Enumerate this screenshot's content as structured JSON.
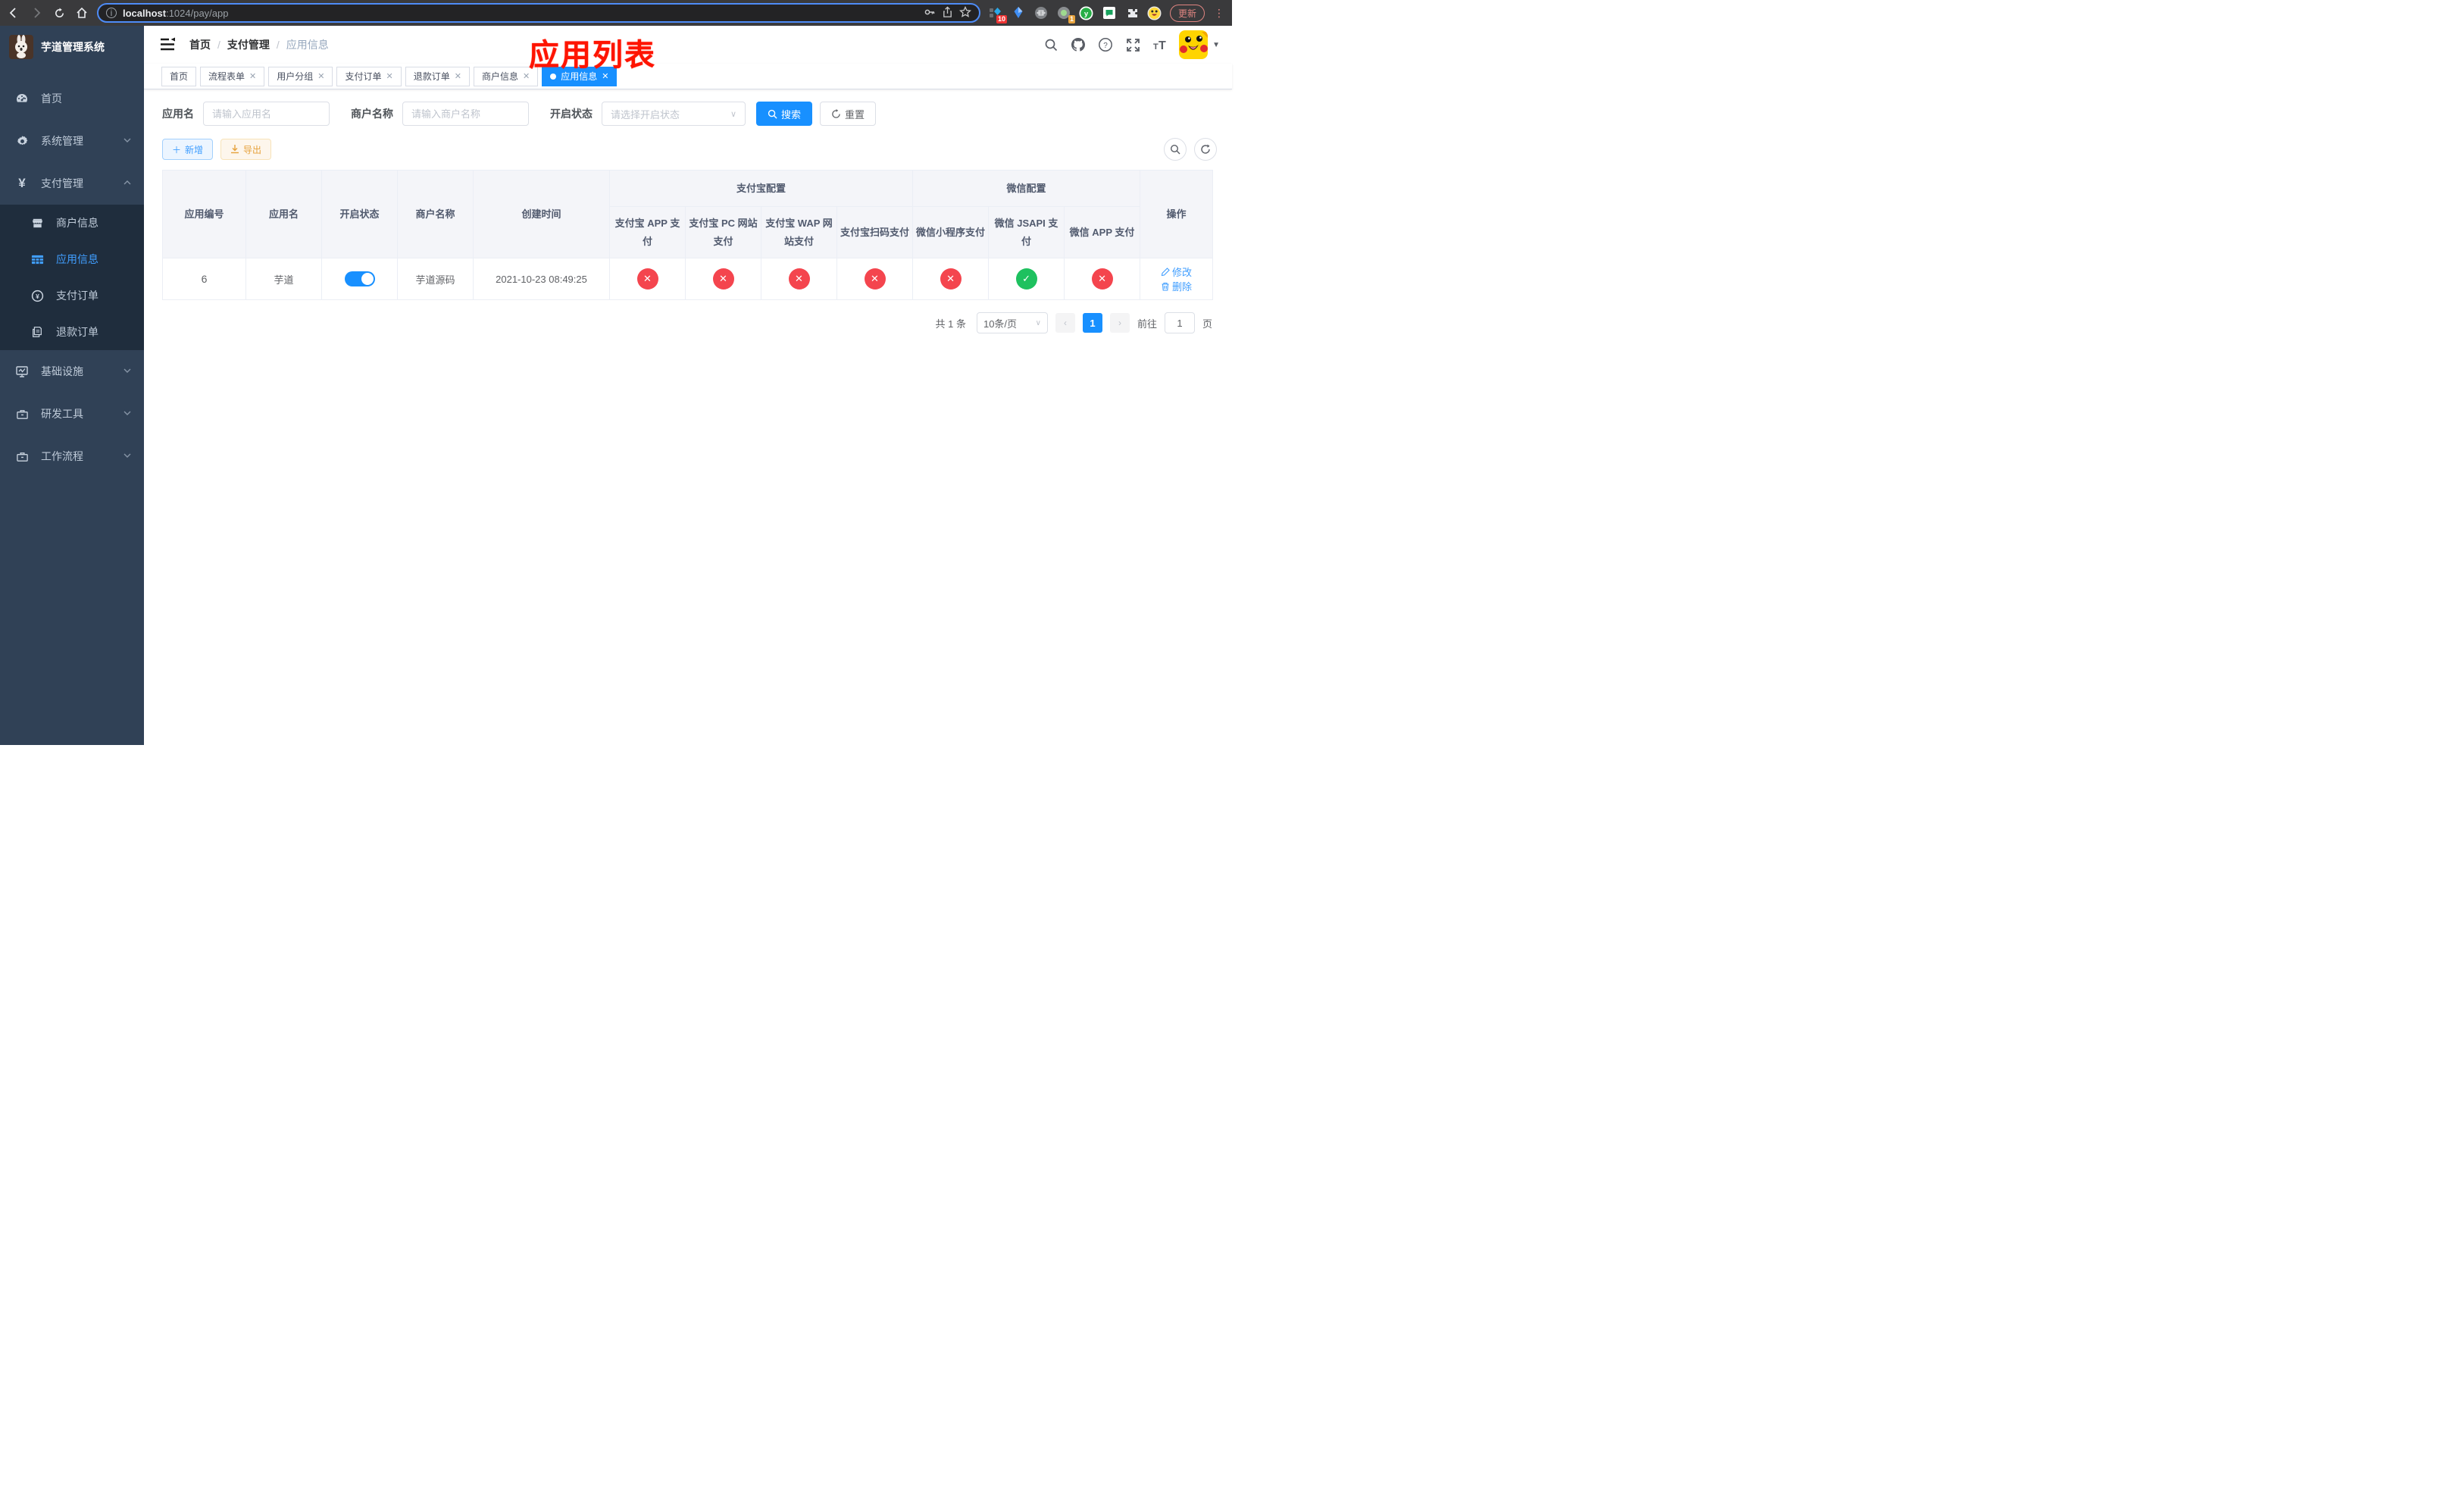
{
  "browser": {
    "url_host": "localhost",
    "url_rest": ":1024/pay/app",
    "update_label": "更新",
    "ext_badge_blue": "10",
    "ext_badge_orange": "1"
  },
  "sidebar": {
    "title": "芋道管理系统",
    "home": "首页",
    "system": "系统管理",
    "pay": "支付管理",
    "merchant_info": "商户信息",
    "app_info": "应用信息",
    "pay_order": "支付订单",
    "refund_order": "退款订单",
    "infra": "基础设施",
    "dev_tools": "研发工具",
    "workflow": "工作流程"
  },
  "breadcrumb": {
    "items": [
      "首页",
      "支付管理",
      "应用信息"
    ]
  },
  "annotation": "应用列表",
  "tabs": [
    {
      "label": "首页",
      "closable": false,
      "active": false
    },
    {
      "label": "流程表单",
      "closable": true,
      "active": false
    },
    {
      "label": "用户分组",
      "closable": true,
      "active": false
    },
    {
      "label": "支付订单",
      "closable": true,
      "active": false
    },
    {
      "label": "退款订单",
      "closable": true,
      "active": false
    },
    {
      "label": "商户信息",
      "closable": true,
      "active": false
    },
    {
      "label": "应用信息",
      "closable": true,
      "active": true
    }
  ],
  "search": {
    "app_name_label": "应用名",
    "app_name_placeholder": "请输入应用名",
    "merchant_label": "商户名称",
    "merchant_placeholder": "请输入商户名称",
    "status_label": "开启状态",
    "status_placeholder": "请选择开启状态",
    "search_btn": "搜索",
    "reset_btn": "重置"
  },
  "toolbar": {
    "add_label": "新增",
    "export_label": "导出"
  },
  "table": {
    "columns": {
      "app_id": "应用编号",
      "app_name": "应用名",
      "status": "开启状态",
      "merchant": "商户名称",
      "created": "创建时间",
      "alipay_group": "支付宝配置",
      "wechat_group": "微信配置",
      "ops": "操作",
      "channels": [
        "支付宝 APP 支付",
        "支付宝 PC 网站支付",
        "支付宝 WAP 网站支付",
        "支付宝扫码支付",
        "微信小程序支付",
        "微信 JSAPI 支付",
        "微信 APP 支付"
      ]
    },
    "rows": [
      {
        "id": "6",
        "name": "芋道",
        "enabled": true,
        "merchant": "芋道源码",
        "created": "2021-10-23 08:49:25",
        "channels": [
          false,
          false,
          false,
          false,
          false,
          true,
          false
        ],
        "edit_label": "修改",
        "delete_label": "删除"
      }
    ]
  },
  "pagination": {
    "total": "共 1 条",
    "page_size": "10条/页",
    "page": "1",
    "goto_prefix": "前往",
    "goto_value": "1",
    "goto_suffix": "页"
  },
  "colors": {
    "accent": "#1890ff",
    "link": "#409eff",
    "success": "#1ec15f",
    "danger": "#f4454e",
    "warning": "#e6a23c",
    "sidebar_bg": "#304156",
    "submenu_bg": "#1f2d3d"
  }
}
